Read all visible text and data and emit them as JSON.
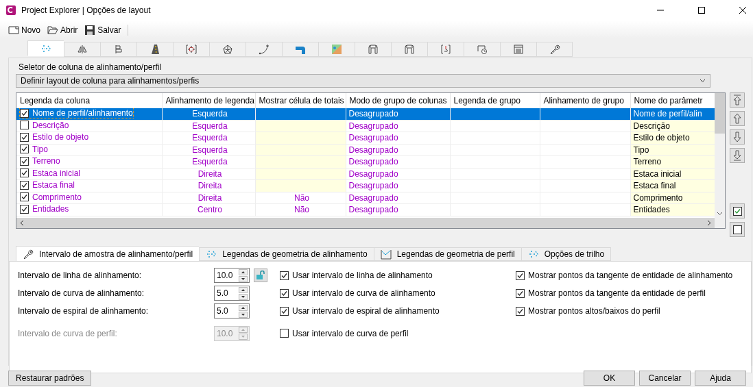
{
  "window": {
    "title": "Project Explorer | Opções de layout"
  },
  "toolbar": [
    {
      "kind": "new",
      "label": "Novo"
    },
    {
      "kind": "open",
      "label": "Abrir"
    },
    {
      "kind": "save",
      "label": "Salvar"
    }
  ],
  "icon_tabs": [
    {
      "kind": "dashed-arrow",
      "selected": true
    },
    {
      "kind": "mirror",
      "selected": false
    },
    {
      "kind": "flag",
      "selected": false
    },
    {
      "kind": "road",
      "selected": false
    },
    {
      "kind": "target",
      "selected": false
    },
    {
      "kind": "polygon",
      "selected": false
    },
    {
      "kind": "curve",
      "selected": false
    },
    {
      "kind": "corner",
      "selected": false
    },
    {
      "kind": "map",
      "selected": false
    },
    {
      "kind": "pipe",
      "selected": false
    },
    {
      "kind": "pipe",
      "selected": false
    },
    {
      "kind": "bracket",
      "selected": false
    },
    {
      "kind": "clock",
      "selected": false
    },
    {
      "kind": "list",
      "selected": false
    },
    {
      "kind": "wrench",
      "selected": false
    }
  ],
  "group_title": "Seletor de coluna de alinhamento/perfil",
  "layout_select": {
    "value": "Definir layout de coluna para alinhamentos/perfis"
  },
  "table": {
    "columns": [
      "Legenda da coluna",
      "Alinhamento de legenda",
      "Mostrar célula de totais",
      "Modo de grupo de colunas",
      "Legenda de grupo",
      "Alinhamento de grupo",
      "Nome do parâmetr"
    ],
    "rows": [
      {
        "checked": true,
        "selected": true,
        "legend": "Nome de perfil/alinhamento",
        "align": "Esquerda",
        "group_mode": "Desagrupado",
        "param": "Nome de perfil/alin"
      },
      {
        "checked": false,
        "selected": false,
        "legend": "Descrição",
        "align": "Esquerda",
        "group_mode": "Desagrupado",
        "param": "Descrição"
      },
      {
        "checked": true,
        "selected": false,
        "legend": "Estilo de objeto",
        "align": "Esquerda",
        "group_mode": "Desagrupado",
        "param": "Estilo de objeto"
      },
      {
        "checked": true,
        "selected": false,
        "legend": "Tipo",
        "align": "Esquerda",
        "group_mode": "Desagrupado",
        "param": "Tipo"
      },
      {
        "checked": true,
        "selected": false,
        "legend": "Terreno",
        "align": "Esquerda",
        "group_mode": "Desagrupado",
        "param": "Terreno"
      },
      {
        "checked": true,
        "selected": false,
        "legend": "Estaca inicial",
        "align": "Direita",
        "group_mode": "Desagrupado",
        "param": "Estaca inicial"
      },
      {
        "checked": true,
        "selected": false,
        "legend": "Estaca final",
        "align": "Direita",
        "group_mode": "Desagrupado",
        "param": "Estaca final"
      },
      {
        "checked": true,
        "selected": false,
        "legend": "Comprimento",
        "align": "Direita",
        "totals": "Não",
        "group_mode": "Desagrupado",
        "param": "Comprimento"
      },
      {
        "checked": true,
        "selected": false,
        "legend": "Entidades",
        "align": "Centro",
        "totals": "Não",
        "group_mode": "Desagrupado",
        "param": "Entidades"
      }
    ]
  },
  "lower_tabs": [
    {
      "kind": "wrench",
      "label": "Intervalo de amostra de alinhamento/perfil",
      "selected": true
    },
    {
      "kind": "dashed-arrow",
      "label": "Legendas de geometria de alinhamento",
      "selected": false
    },
    {
      "kind": "profile",
      "label": "Legendas de geometria de perfil",
      "selected": false
    },
    {
      "kind": "dashed-arrow",
      "label": "Opções de trilho",
      "selected": false
    }
  ],
  "fields": [
    {
      "label": "Intervalo de linha de alinhamento:",
      "value": "10.0",
      "disabled": false,
      "kind": "spin-lock"
    },
    {
      "label": "Intervalo de curva de alinhamento:",
      "value": "5.0",
      "disabled": false,
      "kind": "spin"
    },
    {
      "label": "Intervalo de espiral de alinhamento:",
      "value": "5.0",
      "disabled": false,
      "kind": "spin"
    },
    {
      "label": "Intervalo de curva de perfil:",
      "value": "10.0",
      "disabled": true,
      "kind": "spin"
    }
  ],
  "options_left": [
    {
      "label": "Usar intervalo de linha de alinhamento",
      "checked": true
    },
    {
      "label": "Usar intervalo de curva de alinhamento",
      "checked": true
    },
    {
      "label": "Usar intervalo de espiral de alinhamento",
      "checked": true
    },
    {
      "label": "Usar intervalo de curva de perfil",
      "checked": false
    }
  ],
  "options_right": [
    {
      "label": "Mostrar pontos da tangente de entidade de alinhamento",
      "checked": true
    },
    {
      "label": "Mostrar pontos da tangente da entidade de perfil",
      "checked": true
    },
    {
      "label": "Mostrar pontos altos/baixos do perfil",
      "checked": true
    }
  ],
  "footer": {
    "restore": "Restaurar padrões",
    "buttons": [
      "OK",
      "Cancelar",
      "Ajuda"
    ]
  }
}
